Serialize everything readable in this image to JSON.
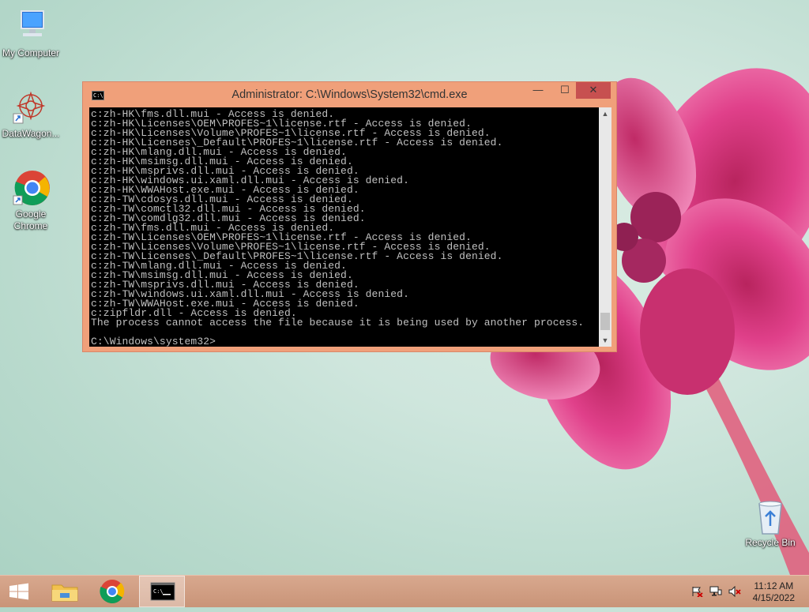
{
  "desktop": {
    "icons": [
      {
        "label": "My Computer",
        "icon": "computer-icon"
      },
      {
        "label": "DataWagon...",
        "icon": "datawagon-icon"
      },
      {
        "label": "Google\nChrome",
        "icon": "chrome-icon"
      },
      {
        "label": "Recycle Bin",
        "icon": "recycle-bin-icon"
      }
    ]
  },
  "window": {
    "title": "Administrator: C:\\Windows\\System32\\cmd.exe",
    "icon_glyph": "C:\\",
    "buttons": {
      "minimize": "—",
      "maximize": "☐",
      "close": "✕"
    },
    "console_lines": [
      "c:zh-HK\\fms.dll.mui - Access is denied.",
      "c:zh-HK\\Licenses\\OEM\\PROFES~1\\license.rtf - Access is denied.",
      "c:zh-HK\\Licenses\\Volume\\PROFES~1\\license.rtf - Access is denied.",
      "c:zh-HK\\Licenses\\_Default\\PROFES~1\\license.rtf - Access is denied.",
      "c:zh-HK\\mlang.dll.mui - Access is denied.",
      "c:zh-HK\\msimsg.dll.mui - Access is denied.",
      "c:zh-HK\\msprivs.dll.mui - Access is denied.",
      "c:zh-HK\\windows.ui.xaml.dll.mui - Access is denied.",
      "c:zh-HK\\WWAHost.exe.mui - Access is denied.",
      "c:zh-TW\\cdosys.dll.mui - Access is denied.",
      "c:zh-TW\\comctl32.dll.mui - Access is denied.",
      "c:zh-TW\\comdlg32.dll.mui - Access is denied.",
      "c:zh-TW\\fms.dll.mui - Access is denied.",
      "c:zh-TW\\Licenses\\OEM\\PROFES~1\\license.rtf - Access is denied.",
      "c:zh-TW\\Licenses\\Volume\\PROFES~1\\license.rtf - Access is denied.",
      "c:zh-TW\\Licenses\\_Default\\PROFES~1\\license.rtf - Access is denied.",
      "c:zh-TW\\mlang.dll.mui - Access is denied.",
      "c:zh-TW\\msimsg.dll.mui - Access is denied.",
      "c:zh-TW\\msprivs.dll.mui - Access is denied.",
      "c:zh-TW\\windows.ui.xaml.dll.mui - Access is denied.",
      "c:zh-TW\\WWAHost.exe.mui - Access is denied.",
      "c:zipfldr.dll - Access is denied.",
      "The process cannot access the file because it is being used by another process.",
      "",
      "C:\\Windows\\system32>"
    ]
  },
  "taskbar": {
    "start_icon": "windows-start-icon",
    "pinned": [
      "file-explorer-icon",
      "chrome-icon",
      "cmd-icon"
    ],
    "tray": [
      "action-center-flag-icon",
      "network-icon",
      "volume-muted-icon"
    ],
    "time": "11:12 AM",
    "date": "4/15/2022"
  },
  "colors": {
    "window_frame": "#f0a07a",
    "close_button": "#c75050",
    "console_bg": "#000000",
    "console_text": "#c0c0c0"
  }
}
